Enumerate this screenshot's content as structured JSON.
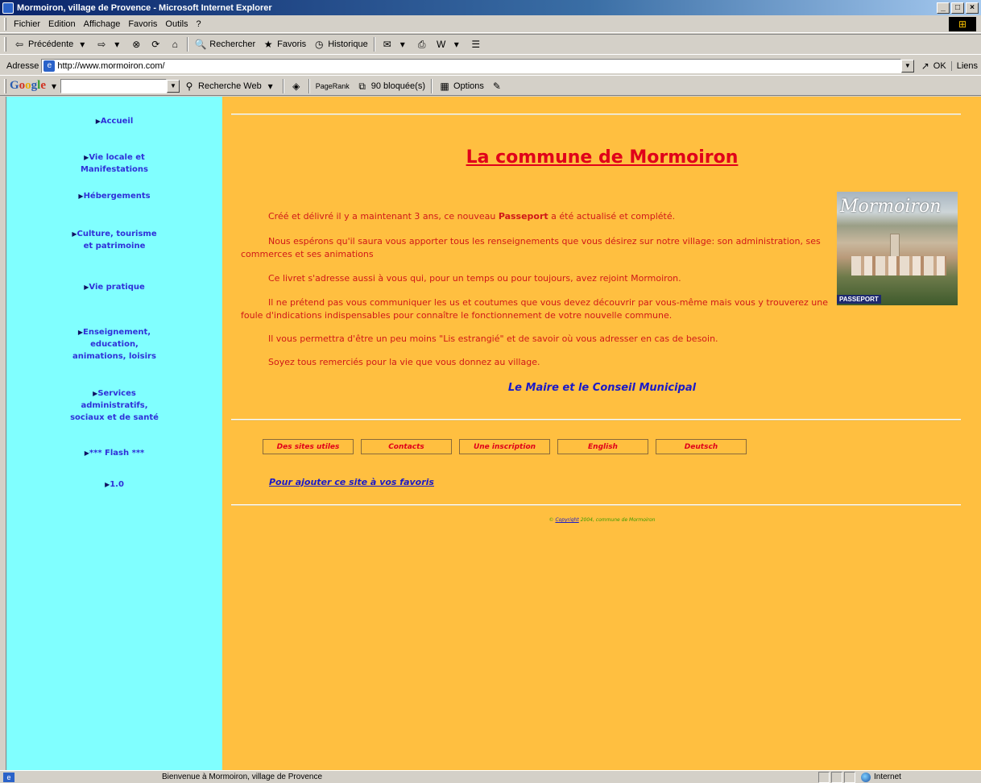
{
  "window": {
    "title": "Mormoiron, village de Provence - Microsoft Internet Explorer",
    "buttons": {
      "minimize": "_",
      "maximize": "□",
      "close": "×"
    }
  },
  "menubar": [
    "Fichier",
    "Edition",
    "Affichage",
    "Favoris",
    "Outils",
    "?"
  ],
  "toolbar": {
    "back": "Précédente",
    "search": "Rechercher",
    "favorites": "Favoris",
    "history": "Historique"
  },
  "address": {
    "label": "Adresse",
    "url": "http://www.mormoiron.com/",
    "go": "OK",
    "links": "Liens"
  },
  "google": {
    "logo": "Google",
    "search_web": "Recherche Web",
    "pagerank": "PageRank",
    "blocked": "90 bloquée(s)",
    "options": "Options"
  },
  "sidebar": {
    "items": [
      [
        "Accueil"
      ],
      [
        "Vie locale et",
        "Manifestations"
      ],
      [
        "Hébergements"
      ],
      [
        "Culture, tourisme",
        "et patrimoine"
      ],
      [
        "Vie pratique"
      ],
      [
        "Enseignement,",
        "education,",
        "animations, loisirs"
      ],
      [
        "Services",
        "administratifs,",
        "sociaux et de santé"
      ],
      [
        "*** Flash ***"
      ],
      [
        "1.0"
      ]
    ]
  },
  "content": {
    "title": "La commune de Mormoiron",
    "p1_before": "Créé et délivré il y a maintenant 3 ans, ce nouveau",
    "p1_bold": "Passeport",
    "p1_after": "a été actualisé et complété.",
    "p2": "Nous espérons qu'il saura vous apporter tous les renseignements que vous désirez sur notre village: son administration, ses commerces et ses animations",
    "p3": "Ce livret s'adresse aussi à vous qui, pour un temps ou pour toujours, avez rejoint Mormoiron.",
    "p4": "Il ne prétend pas vous communiquer les us et coutumes que vous devez découvrir par vous-même mais vous y trouverez une foule d'indications indispensables pour connaître le fonctionnement de votre nouvelle commune.",
    "p5": "Il vous permettra d'être un peu moins \"Lis estrangié\" et de savoir où vous adresser en cas de besoin.",
    "p6": "Soyez tous remerciés pour la vie que vous donnez au village.",
    "signature": "Le Maire et le Conseil Municipal",
    "passport_word": "Mormoiron",
    "passport_label": "PASSEPORT",
    "buttons": [
      "Des sites utiles",
      "Contacts",
      "Une inscription",
      "English",
      "Deutsch"
    ],
    "favorites_link": "Pour ajouter ce site à vos favoris",
    "copyright_prefix": "©",
    "copyright_link": "Copyright",
    "copyright_suffix": "2004, commune de Mormoiron"
  },
  "statusbar": {
    "text": "Bienvenue à Mormoiron, village de Provence",
    "zone": "Internet"
  },
  "colors": {
    "sidebar_bg": "#80ffff",
    "content_bg": "#ffbf40",
    "title_red": "#e0001a",
    "link_blue": "#1a1ac8"
  }
}
